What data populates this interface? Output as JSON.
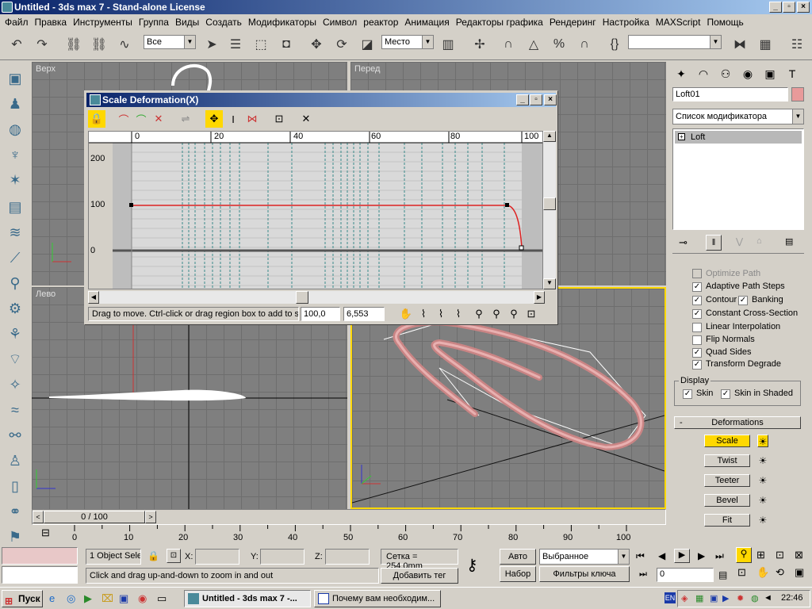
{
  "window": {
    "title": "Untitled - 3ds max 7 - Stand-alone License"
  },
  "menu": [
    "Файл",
    "Правка",
    "Инструменты",
    "Группа",
    "Виды",
    "Создать",
    "Модификаторы",
    "Символ",
    "реактор",
    "Анимация",
    "Редакторы графика",
    "Рендеринг",
    "Настройка",
    "MAXScript",
    "Помощь"
  ],
  "toolbar": {
    "selection_filter": "Все",
    "coord_system": "Место",
    "named_selection": ""
  },
  "viewports": {
    "top": "Верх",
    "front": "Перед",
    "left": "Лево",
    "perspective": ""
  },
  "dialog": {
    "title": "Scale Deformation(X)",
    "ruler_labels": [
      "0",
      "20",
      "40",
      "60",
      "80",
      "100"
    ],
    "y_labels": [
      "200",
      "100",
      "0"
    ],
    "status_hint": "Drag to move. Ctrl-click or drag region box to add to sel",
    "field_x": "100,0",
    "field_y": "6,553"
  },
  "right_panel": {
    "object_name": "Loft01",
    "object_color": "#e89a9a",
    "modifier_list": "Список модификатора",
    "stack_item": "Loft",
    "options": [
      {
        "label": "Optimize Path",
        "checked": false,
        "disabled": true
      },
      {
        "label": "Adaptive Path Steps",
        "checked": true,
        "disabled": false
      },
      {
        "label": "Contour",
        "checked": true,
        "disabled": false
      },
      {
        "label": "Constant Cross-Section",
        "checked": true,
        "disabled": false
      },
      {
        "label": "Linear Interpolation",
        "checked": false,
        "disabled": false
      },
      {
        "label": "Flip Normals",
        "checked": false,
        "disabled": false
      },
      {
        "label": "Quad Sides",
        "checked": true,
        "disabled": false
      },
      {
        "label": "Transform Degrade",
        "checked": true,
        "disabled": false
      }
    ],
    "banking_label": "Banking",
    "display_title": "Display",
    "skin_label": "Skin",
    "skin_shaded_label": "Skin in Shaded",
    "deformations_title": "Deformations",
    "deformations_collapse": "-",
    "deform_buttons": [
      "Scale",
      "Twist",
      "Teeter",
      "Bevel",
      "Fit"
    ]
  },
  "timeline": {
    "frame": "0 / 100",
    "ticks": [
      "0",
      "10",
      "20",
      "30",
      "40",
      "50",
      "60",
      "70",
      "80",
      "90",
      "100"
    ]
  },
  "status": {
    "selection": "1 Object Sele",
    "x_label": "X:",
    "y_label": "Y:",
    "z_label": "Z:",
    "grid": "Сетка = 254,0mm",
    "hint": "Click and drag up-and-down to zoom in and out",
    "add_tag": "Добавить тег",
    "auto": "Авто",
    "set": "Набор",
    "key_filter_select": "Выбранное",
    "key_filters": "Фильтры ключа",
    "frame_field": "0"
  },
  "taskbar": {
    "start": "Пуск",
    "items": [
      "Untitled - 3ds max 7 -...",
      "Почему вам необходим..."
    ],
    "lang": "EN",
    "clock": "22:46"
  }
}
